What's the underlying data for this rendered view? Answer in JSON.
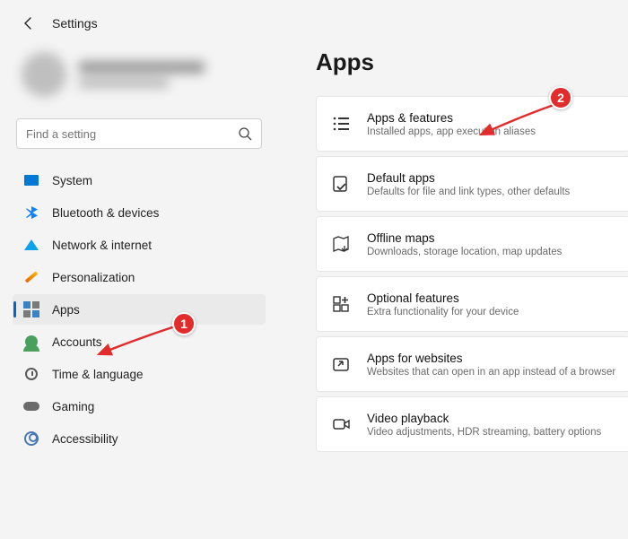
{
  "header": {
    "title": "Settings"
  },
  "search": {
    "placeholder": "Find a setting"
  },
  "sidebar": {
    "items": [
      {
        "label": "System"
      },
      {
        "label": "Bluetooth & devices"
      },
      {
        "label": "Network & internet"
      },
      {
        "label": "Personalization"
      },
      {
        "label": "Apps"
      },
      {
        "label": "Accounts"
      },
      {
        "label": "Time & language"
      },
      {
        "label": "Gaming"
      },
      {
        "label": "Accessibility"
      }
    ]
  },
  "main": {
    "title": "Apps",
    "cards": [
      {
        "title": "Apps & features",
        "sub": "Installed apps, app execution aliases"
      },
      {
        "title": "Default apps",
        "sub": "Defaults for file and link types, other defaults"
      },
      {
        "title": "Offline maps",
        "sub": "Downloads, storage location, map updates"
      },
      {
        "title": "Optional features",
        "sub": "Extra functionality for your device"
      },
      {
        "title": "Apps for websites",
        "sub": "Websites that can open in an app instead of a browser"
      },
      {
        "title": "Video playback",
        "sub": "Video adjustments, HDR streaming, battery options"
      }
    ]
  },
  "annotations": {
    "badge1": "1",
    "badge2": "2"
  }
}
